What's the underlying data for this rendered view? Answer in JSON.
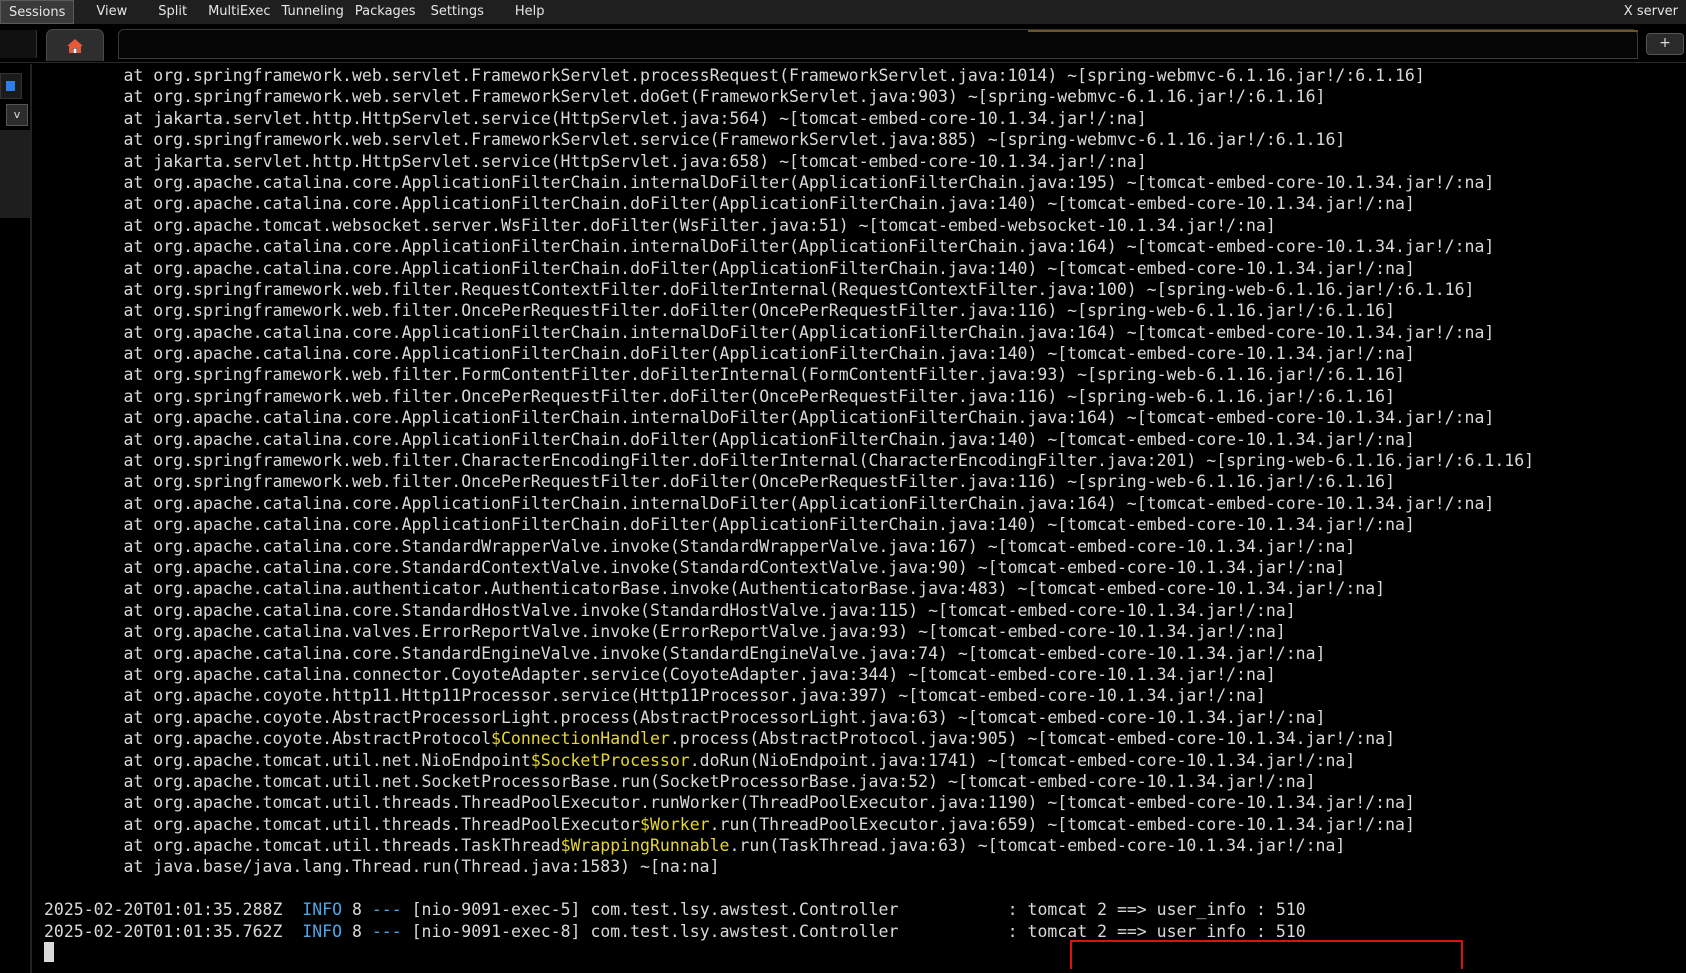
{
  "menubar": {
    "items": [
      "Sessions",
      "View",
      "Split",
      "MultiExec",
      "Tunneling",
      "Packages",
      "Settings",
      "Help"
    ],
    "right_label": "X server"
  },
  "tabs": {
    "add_label": "+",
    "home_icon": "home-icon",
    "home_color": "#e8573a"
  },
  "sidebar": {
    "dropdown_glyph": "v"
  },
  "terminal": {
    "stack_lines": [
      "\tat org.springframework.web.servlet.FrameworkServlet.processRequest(FrameworkServlet.java:1014) ~[spring-webmvc-6.1.16.jar!/:6.1.16]",
      "\tat org.springframework.web.servlet.FrameworkServlet.doGet(FrameworkServlet.java:903) ~[spring-webmvc-6.1.16.jar!/:6.1.16]",
      "\tat jakarta.servlet.http.HttpServlet.service(HttpServlet.java:564) ~[tomcat-embed-core-10.1.34.jar!/:na]",
      "\tat org.springframework.web.servlet.FrameworkServlet.service(FrameworkServlet.java:885) ~[spring-webmvc-6.1.16.jar!/:6.1.16]",
      "\tat jakarta.servlet.http.HttpServlet.service(HttpServlet.java:658) ~[tomcat-embed-core-10.1.34.jar!/:na]",
      "\tat org.apache.catalina.core.ApplicationFilterChain.internalDoFilter(ApplicationFilterChain.java:195) ~[tomcat-embed-core-10.1.34.jar!/:na]",
      "\tat org.apache.catalina.core.ApplicationFilterChain.doFilter(ApplicationFilterChain.java:140) ~[tomcat-embed-core-10.1.34.jar!/:na]",
      "\tat org.apache.tomcat.websocket.server.WsFilter.doFilter(WsFilter.java:51) ~[tomcat-embed-websocket-10.1.34.jar!/:na]",
      "\tat org.apache.catalina.core.ApplicationFilterChain.internalDoFilter(ApplicationFilterChain.java:164) ~[tomcat-embed-core-10.1.34.jar!/:na]",
      "\tat org.apache.catalina.core.ApplicationFilterChain.doFilter(ApplicationFilterChain.java:140) ~[tomcat-embed-core-10.1.34.jar!/:na]",
      "\tat org.springframework.web.filter.RequestContextFilter.doFilterInternal(RequestContextFilter.java:100) ~[spring-web-6.1.16.jar!/:6.1.16]",
      "\tat org.springframework.web.filter.OncePerRequestFilter.doFilter(OncePerRequestFilter.java:116) ~[spring-web-6.1.16.jar!/:6.1.16]",
      "\tat org.apache.catalina.core.ApplicationFilterChain.internalDoFilter(ApplicationFilterChain.java:164) ~[tomcat-embed-core-10.1.34.jar!/:na]",
      "\tat org.apache.catalina.core.ApplicationFilterChain.doFilter(ApplicationFilterChain.java:140) ~[tomcat-embed-core-10.1.34.jar!/:na]",
      "\tat org.springframework.web.filter.FormContentFilter.doFilterInternal(FormContentFilter.java:93) ~[spring-web-6.1.16.jar!/:6.1.16]",
      "\tat org.springframework.web.filter.OncePerRequestFilter.doFilter(OncePerRequestFilter.java:116) ~[spring-web-6.1.16.jar!/:6.1.16]",
      "\tat org.apache.catalina.core.ApplicationFilterChain.internalDoFilter(ApplicationFilterChain.java:164) ~[tomcat-embed-core-10.1.34.jar!/:na]",
      "\tat org.apache.catalina.core.ApplicationFilterChain.doFilter(ApplicationFilterChain.java:140) ~[tomcat-embed-core-10.1.34.jar!/:na]",
      "\tat org.springframework.web.filter.CharacterEncodingFilter.doFilterInternal(CharacterEncodingFilter.java:201) ~[spring-web-6.1.16.jar!/:6.1.16]",
      "\tat org.springframework.web.filter.OncePerRequestFilter.doFilter(OncePerRequestFilter.java:116) ~[spring-web-6.1.16.jar!/:6.1.16]",
      "\tat org.apache.catalina.core.ApplicationFilterChain.internalDoFilter(ApplicationFilterChain.java:164) ~[tomcat-embed-core-10.1.34.jar!/:na]",
      "\tat org.apache.catalina.core.ApplicationFilterChain.doFilter(ApplicationFilterChain.java:140) ~[tomcat-embed-core-10.1.34.jar!/:na]",
      "\tat org.apache.catalina.core.StandardWrapperValve.invoke(StandardWrapperValve.java:167) ~[tomcat-embed-core-10.1.34.jar!/:na]",
      "\tat org.apache.catalina.core.StandardContextValve.invoke(StandardContextValve.java:90) ~[tomcat-embed-core-10.1.34.jar!/:na]",
      "\tat org.apache.catalina.authenticator.AuthenticatorBase.invoke(AuthenticatorBase.java:483) ~[tomcat-embed-core-10.1.34.jar!/:na]",
      "\tat org.apache.catalina.core.StandardHostValve.invoke(StandardHostValve.java:115) ~[tomcat-embed-core-10.1.34.jar!/:na]",
      "\tat org.apache.catalina.valves.ErrorReportValve.invoke(ErrorReportValve.java:93) ~[tomcat-embed-core-10.1.34.jar!/:na]",
      "\tat org.apache.catalina.core.StandardEngineValve.invoke(StandardEngineValve.java:74) ~[tomcat-embed-core-10.1.34.jar!/:na]",
      "\tat org.apache.catalina.connector.CoyoteAdapter.service(CoyoteAdapter.java:344) ~[tomcat-embed-core-10.1.34.jar!/:na]",
      "\tat org.apache.coyote.http11.Http11Processor.service(Http11Processor.java:397) ~[tomcat-embed-core-10.1.34.jar!/:na]",
      "\tat org.apache.coyote.AbstractProcessorLight.process(AbstractProcessorLight.java:63) ~[tomcat-embed-core-10.1.34.jar!/:na]",
      "\tat org.apache.coyote.AbstractProtocol$ConnectionHandler.process(AbstractProtocol.java:905) ~[tomcat-embed-core-10.1.34.jar!/:na]",
      "\tat org.apache.tomcat.util.net.NioEndpoint$SocketProcessor.doRun(NioEndpoint.java:1741) ~[tomcat-embed-core-10.1.34.jar!/:na]",
      "\tat org.apache.tomcat.util.net.SocketProcessorBase.run(SocketProcessorBase.java:52) ~[tomcat-embed-core-10.1.34.jar!/:na]",
      "\tat org.apache.tomcat.util.threads.ThreadPoolExecutor.runWorker(ThreadPoolExecutor.java:1190) ~[tomcat-embed-core-10.1.34.jar!/:na]",
      "\tat org.apache.tomcat.util.threads.ThreadPoolExecutor$Worker.run(ThreadPoolExecutor.java:659) ~[tomcat-embed-core-10.1.34.jar!/:na]",
      "\tat org.apache.tomcat.util.threads.TaskThread$WrappingRunnable.run(TaskThread.java:63) ~[tomcat-embed-core-10.1.34.jar!/:na]",
      "\tat java.base/java.lang.Thread.run(Thread.java:1583) ~[na:na]"
    ],
    "log_lines": [
      {
        "timestamp": "2025-02-20T01:01:35.288Z",
        "level": "INFO",
        "pid": "8",
        "sep": "---",
        "thread": "[nio-9091-exec-5]",
        "logger": "com.test.lsy.awstest.Controller",
        "message": ": tomcat 2 ==> user_info : 510"
      },
      {
        "timestamp": "2025-02-20T01:01:35.762Z",
        "level": "INFO",
        "pid": "8",
        "sep": "---",
        "thread": "[nio-9091-exec-8]",
        "logger": "com.test.lsy.awstest.Controller",
        "message": ": tomcat 2 ==> user_info : 510"
      }
    ],
    "colors": {
      "text": "#d9d9d9",
      "inner_class": "#e5d533",
      "info": "#4aa5e8",
      "highlight_box": "#e01010"
    }
  }
}
